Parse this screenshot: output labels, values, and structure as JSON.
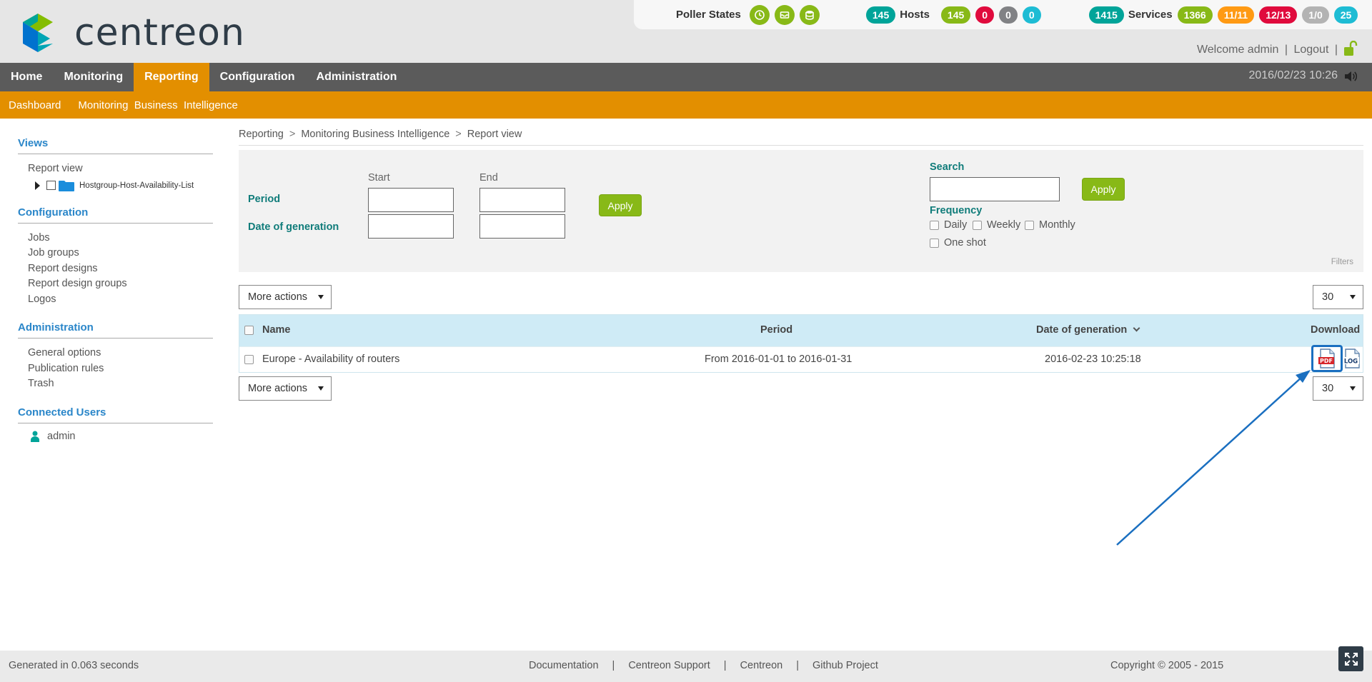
{
  "header": {
    "brand": "centreon",
    "poller_label": "Poller States",
    "hosts": {
      "total": "145",
      "label": "Hosts",
      "up": "145",
      "down": "0",
      "unreachable": "0",
      "pending": "0"
    },
    "services": {
      "total": "1415",
      "label": "Services",
      "ok": "1366",
      "warning": "11/11",
      "critical": "12/13",
      "unknown": "1/0",
      "pending": "25"
    },
    "welcome": "Welcome admin",
    "logout": "Logout",
    "sep": "|",
    "datetime": "2016/02/23 10:26"
  },
  "nav": {
    "items": [
      "Home",
      "Monitoring",
      "Reporting",
      "Configuration",
      "Administration"
    ],
    "sub": [
      "Dashboard",
      "Monitoring  Business  Intelligence"
    ]
  },
  "sidebar": {
    "views_title": "Views",
    "report_view": "Report view",
    "tree_item": "Hostgroup-Host-Availability-List",
    "config_title": "Configuration",
    "config_items": [
      "Jobs",
      "Job groups",
      "Report designs",
      "Report design groups",
      "Logos"
    ],
    "admin_title": "Administration",
    "admin_items": [
      "General options",
      "Publication rules",
      "Trash"
    ],
    "users_title": "Connected Users",
    "user": "admin"
  },
  "breadcrumb": [
    "Reporting",
    "Monitoring Business Intelligence",
    "Report view"
  ],
  "breadcrumb_sep": ">",
  "filters": {
    "start": "Start",
    "end": "End",
    "period": "Period",
    "date_gen": "Date of generation",
    "apply": "Apply",
    "search": "Search",
    "frequency": "Frequency",
    "daily": "Daily",
    "weekly": "Weekly",
    "monthly": "Monthly",
    "oneshot": "One shot",
    "tag": "Filters"
  },
  "toolbar": {
    "more_actions": "More actions",
    "page_size": "30"
  },
  "table": {
    "col_name": "Name",
    "col_period": "Period",
    "col_date": "Date of generation",
    "col_download": "Download",
    "rows": [
      {
        "name": "Europe - Availability of routers",
        "period": "From 2016-01-01 to 2016-01-31",
        "date": "2016-02-23 10:25:18"
      }
    ]
  },
  "footer": {
    "generated": "Generated in 0.063 seconds",
    "links": [
      "Documentation",
      "Centreon Support",
      "Centreon",
      "Github Project"
    ],
    "sep": "|",
    "copyright": "Copyright © 2005 - 2015"
  },
  "colors": {
    "accent": "#e38f00",
    "nav": "#5b5b5b",
    "link": "#2a86c9",
    "ok": "#88b917",
    "critical": "#e00b3d"
  }
}
